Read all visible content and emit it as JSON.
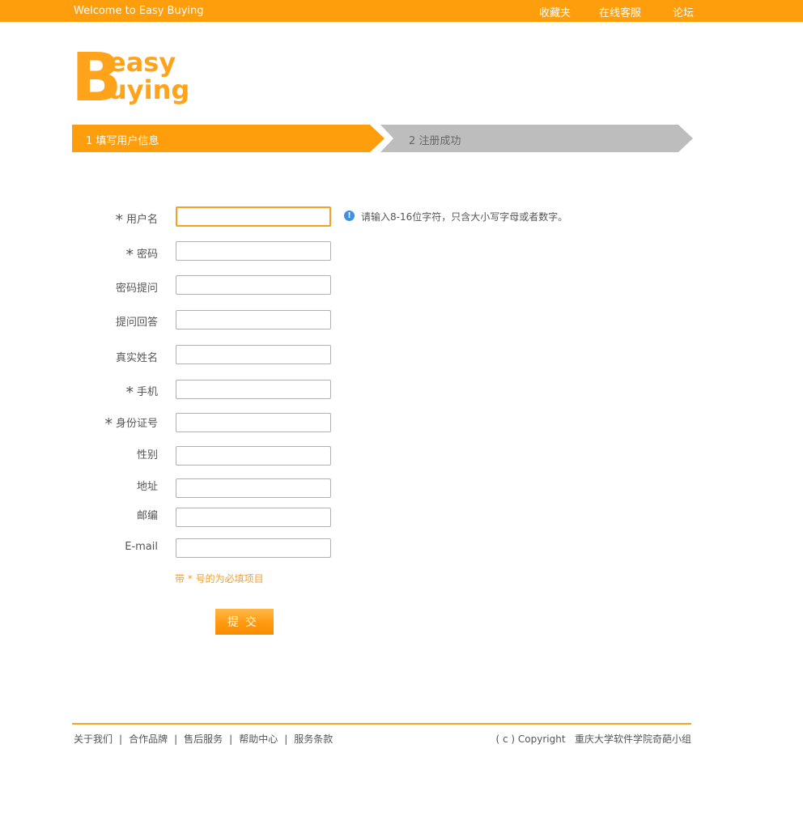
{
  "topbar": {
    "welcome": "Welcome to Easy Buying",
    "links": [
      "收藏夹",
      "在线客服",
      "论坛"
    ]
  },
  "logo": {
    "line1": "easy",
    "line2": "uying",
    "initial": "B"
  },
  "steps": [
    {
      "label": "1 填写用户信息",
      "state": "active",
      "color": "#ff9e0d"
    },
    {
      "label": "2 注册成功",
      "state": "inactive",
      "color": "#bdbdbd"
    }
  ],
  "form": {
    "required_mark": "*",
    "fields": [
      {
        "label": "用户名",
        "required": true,
        "value": "",
        "focused": true
      },
      {
        "label": "密码",
        "required": true,
        "value": ""
      },
      {
        "label": "密码提问",
        "required": false,
        "value": ""
      },
      {
        "label": "提问回答",
        "required": false,
        "value": ""
      },
      {
        "label": "真实姓名",
        "required": false,
        "value": ""
      },
      {
        "label": "手机",
        "required": true,
        "value": ""
      },
      {
        "label": "身份证号",
        "required": true,
        "value": ""
      },
      {
        "label": "性别",
        "required": false,
        "value": ""
      },
      {
        "label": "地址",
        "required": false,
        "value": ""
      },
      {
        "label": "邮编",
        "required": false,
        "value": ""
      },
      {
        "label": "E-mail",
        "required": false,
        "value": ""
      }
    ],
    "hint": {
      "icon": "info-icon",
      "text": "请输入8-16位字符，只含大小写字母或者数字。"
    },
    "required_note": "带 * 号的为必填项目",
    "submit_label": "提交"
  },
  "footer": {
    "links": [
      "关于我们",
      "合作品牌",
      "售后服务",
      "帮助中心",
      "服务条款"
    ],
    "separator": "|",
    "copyright": "( c ) Copyright",
    "org": "重庆大学软件学院奇葩小组"
  },
  "colors": {
    "accent": "#ff9e0d",
    "inactive_step": "#bdbdbd",
    "text": "#555555",
    "info": "#3d91e0"
  }
}
